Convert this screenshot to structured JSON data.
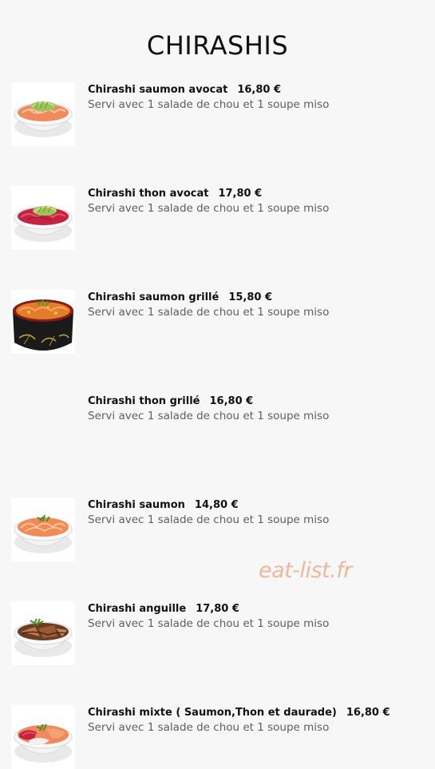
{
  "header": {
    "title": "CHIRASHIS"
  },
  "items": [
    {
      "name": "Chirashi saumon avocat",
      "price": "16,80 €",
      "description": "Servi avec 1 salade de chou et 1 soupe miso",
      "image": "salmon-avocado-bowl"
    },
    {
      "name": "Chirashi thon avocat",
      "price": "17,80 €",
      "description": "Servi avec 1 salade de chou et 1 soupe miso",
      "image": "tuna-avocado-bowl"
    },
    {
      "name": "Chirashi saumon grillé",
      "price": "15,80 €",
      "description": "Servi avec 1 salade de chou et 1 soupe miso",
      "image": "grilled-salmon-lacquer-bowl"
    },
    {
      "name": "Chirashi thon grillé",
      "price": "16,80 €",
      "description": "Servi avec 1 salade de chou et 1 soupe miso",
      "image": ""
    },
    {
      "name": "Chirashi saumon",
      "price": "14,80 €",
      "description": "Servi avec 1 salade de chou et 1 soupe miso",
      "image": "salmon-bowl"
    },
    {
      "name": "Chirashi anguille",
      "price": "17,80 €",
      "description": "Servi avec 1 salade de chou et 1 soupe miso",
      "image": "eel-bowl"
    },
    {
      "name": "Chirashi mixte ( Saumon,Thon et daurade)",
      "price": "16,80 €",
      "description": "Servi avec 1 salade de chou et 1 soupe miso",
      "image": "mixed-fish-bowl"
    }
  ],
  "watermark": "eat-list.fr",
  "colors": {
    "background": "#f7f7f7",
    "title": "#111111",
    "description": "#5f5f5f",
    "watermark": "#f2b79a"
  }
}
